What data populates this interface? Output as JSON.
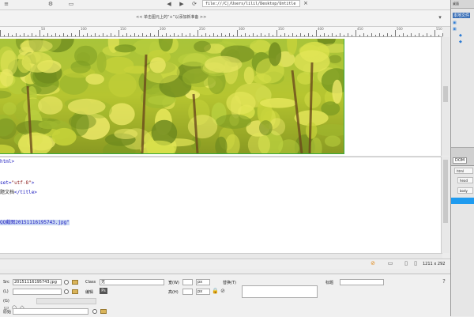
{
  "toolbar": {
    "address": "file:///C|/Users/lilil/Desktop/Untitle",
    "close": "×"
  },
  "docbar": {
    "prompt": "<< 单击图元上的“+”以添加新准备 >>"
  },
  "ruler": {
    "labels": [
      "50",
      "100",
      "150",
      "200",
      "250",
      "300",
      "350",
      "400",
      "450",
      "500",
      "550"
    ]
  },
  "code": {
    "line1": "html>",
    "line2_a": "set=",
    "line2_b": "\"utf-8\"",
    "line2_c": ">",
    "line3_a": "题文档",
    "line3_b": "</title>",
    "line4": "QQ截图20151116195743.jpg\""
  },
  "status": {
    "size": "1211 x 292"
  },
  "properties": {
    "src_label": "Src",
    "src_value": "20151116195743.jpg",
    "class_label": "Class",
    "class_value": "无",
    "edit_label": "编辑",
    "width_label": "宽(W)",
    "width_unit": "px",
    "height_label": "高(H)",
    "height_unit": "px",
    "alt_label": "替换(T)",
    "title_label": "标题",
    "link_label": "(L)",
    "target_label": "(G)",
    "orig_label": "原始"
  },
  "right_panel": {
    "title": "桌面",
    "files_label": "本地文件",
    "dom_tab": "DOM",
    "nodes": [
      "html",
      "head",
      "body"
    ]
  },
  "colors": {
    "code_keyword": "#1d1dbf",
    "selection": "#c8d6f3",
    "guide_green": "#3aaa3a",
    "dom_selected": "#1f9bef"
  }
}
